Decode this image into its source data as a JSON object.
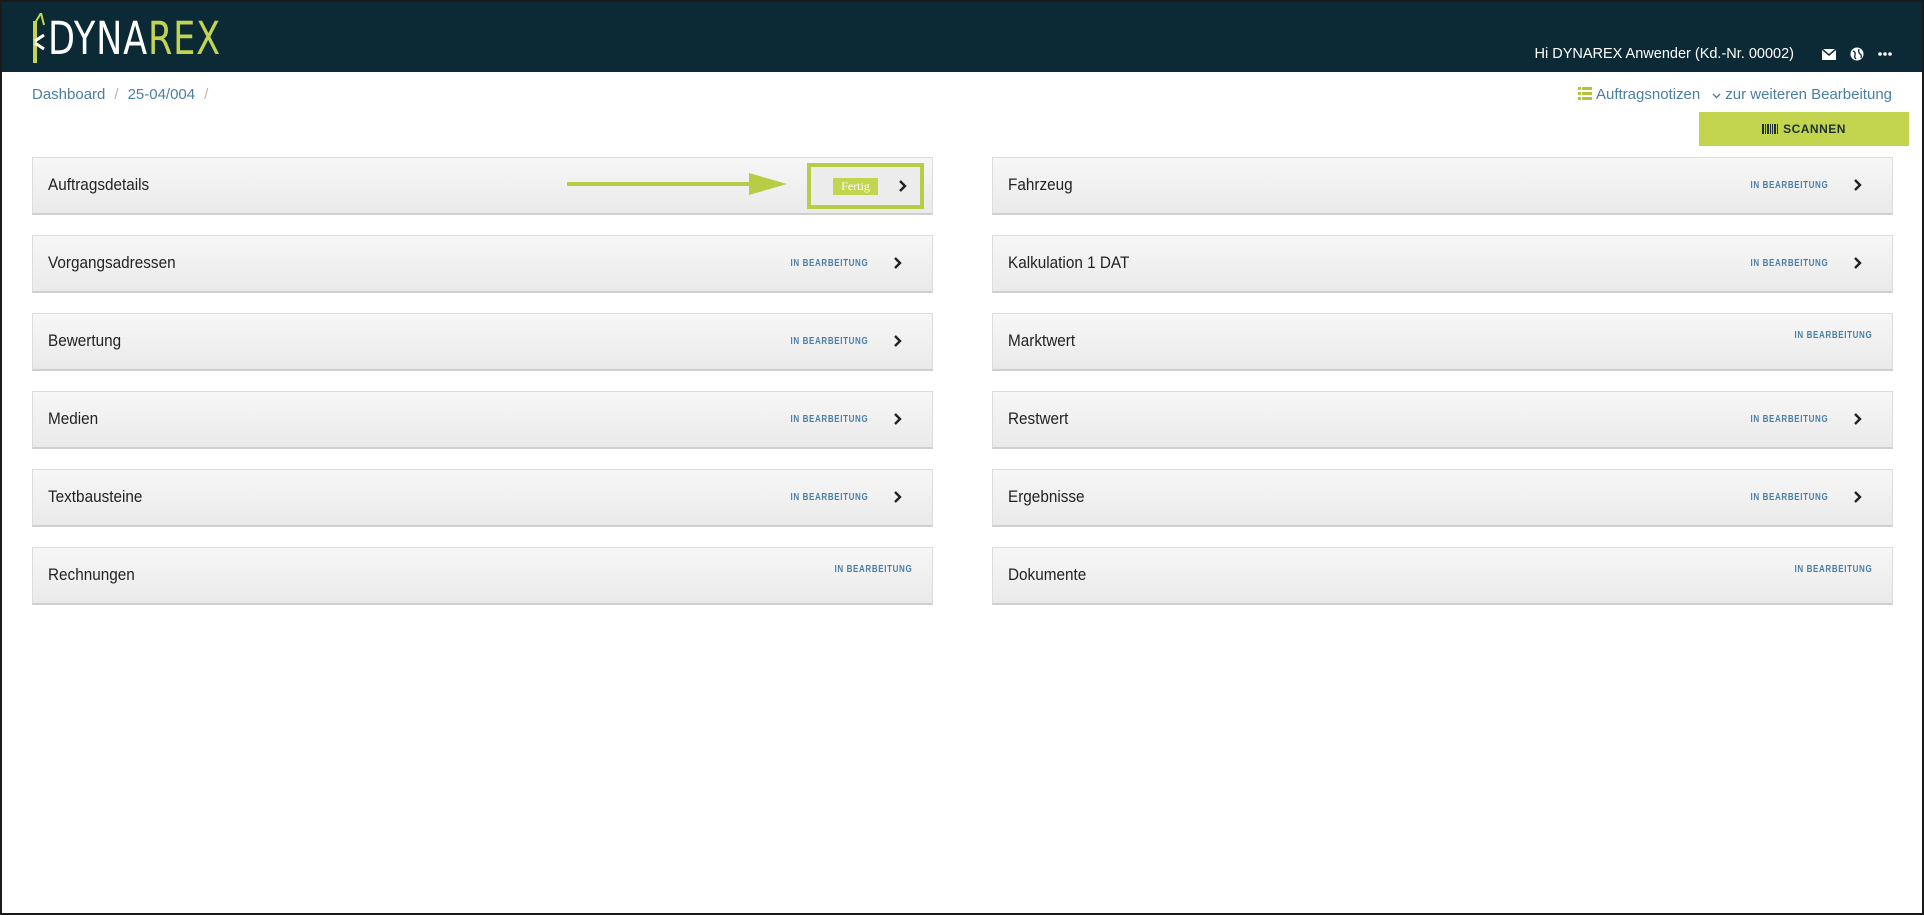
{
  "brand": {
    "logo_part1": "DYNA",
    "logo_part2": "REX",
    "accent": "#c3d44e",
    "header_bg": "#0b2a36"
  },
  "header": {
    "greeting": "Hi DYNAREX Anwender (Kd.-Nr. 00002)",
    "icons": [
      "envelope-icon",
      "globe-icon",
      "more-icon"
    ]
  },
  "breadcrumb": {
    "items": [
      "Dashboard",
      "25-04/004"
    ],
    "separator": "/"
  },
  "actions": {
    "notes": "Auftragsnotizen",
    "further": "zur weiteren Bearbeitung"
  },
  "scan_button": {
    "label": "SCANNEN"
  },
  "status_colors": {
    "in_progress": "#4a7fa4",
    "done": "#c3d44e"
  },
  "panels": {
    "left": [
      {
        "title": "Auftragsdetails",
        "status": "Fertig",
        "state": "done",
        "chevron": true
      },
      {
        "title": "Vorgangsadressen",
        "status": "IN BEARBEITUNG",
        "state": "in_progress",
        "chevron": true
      },
      {
        "title": "Bewertung",
        "status": "IN BEARBEITUNG",
        "state": "in_progress",
        "chevron": true
      },
      {
        "title": "Medien",
        "status": "IN BEARBEITUNG",
        "state": "in_progress",
        "chevron": true
      },
      {
        "title": "Textbausteine",
        "status": "IN BEARBEITUNG",
        "state": "in_progress",
        "chevron": true
      },
      {
        "title": "Rechnungen",
        "status": "IN BEARBEITUNG",
        "state": "in_progress",
        "chevron": false
      }
    ],
    "right": [
      {
        "title": "Fahrzeug",
        "status": "IN BEARBEITUNG",
        "state": "in_progress",
        "chevron": true
      },
      {
        "title": "Kalkulation 1 DAT",
        "status": "IN BEARBEITUNG",
        "state": "in_progress",
        "chevron": true
      },
      {
        "title": "Marktwert",
        "status": "IN BEARBEITUNG",
        "state": "in_progress",
        "chevron": false
      },
      {
        "title": "Restwert",
        "status": "IN BEARBEITUNG",
        "state": "in_progress",
        "chevron": true
      },
      {
        "title": "Ergebnisse",
        "status": "IN BEARBEITUNG",
        "state": "in_progress",
        "chevron": true
      },
      {
        "title": "Dokumente",
        "status": "IN BEARBEITUNG",
        "state": "in_progress",
        "chevron": false
      }
    ]
  }
}
